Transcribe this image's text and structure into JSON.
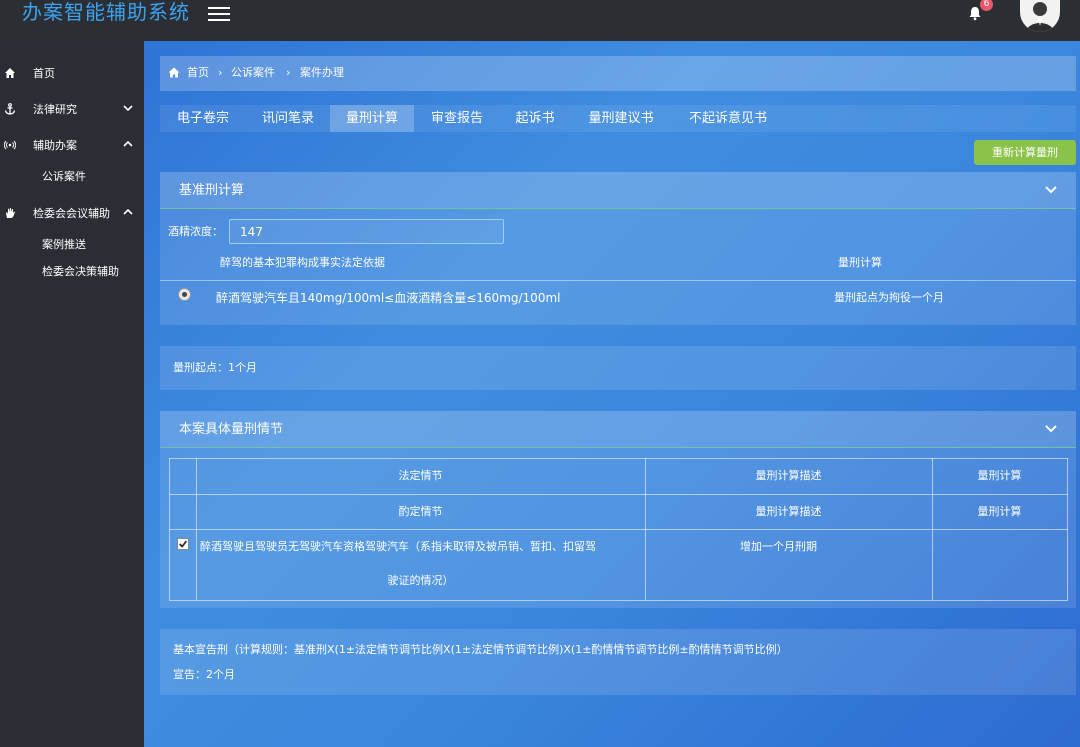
{
  "app": {
    "title": "办案智能辅助系统",
    "notification_count": "6"
  },
  "sidebar": {
    "items": [
      {
        "label": "首页"
      },
      {
        "label": "法律研究"
      },
      {
        "label": "辅助办案"
      },
      {
        "label": "公诉案件"
      },
      {
        "label": "检委会会议辅助"
      },
      {
        "label": "案例推送"
      },
      {
        "label": "检委会决策辅助"
      }
    ]
  },
  "breadcrumb": {
    "home": "首页",
    "level2": "公诉案件",
    "level3": "案件办理"
  },
  "tabs": [
    "电子卷宗",
    "讯问笔录",
    "量刑计算",
    "审查报告",
    "起诉书",
    "量刑建议书",
    "不起诉意见书"
  ],
  "actions": {
    "recalc_label": "重新计算量刑"
  },
  "base_calc": {
    "title": "基准刑计算",
    "alcohol_label": "酒精浓度：",
    "alcohol_value": "147",
    "col_basis": "醉驾的基本犯罪构成事实法定依据",
    "col_calc": "量刑计算",
    "row_basis": "醉酒驾驶汽车且140mg/100ml≤血液酒精含量≤160mg/100ml",
    "row_calc": "量刑起点为拘役一个月"
  },
  "start_point": {
    "text": "量刑起点：1个月"
  },
  "circumstances": {
    "title": "本案具体量刑情节",
    "statutory_header": "法定情节",
    "desc_header": "量刑计算描述",
    "calc_header": "量刑计算",
    "discretionary_header": "酌定情节",
    "desc_header2": "量刑计算描述",
    "calc_header2": "量刑计算",
    "row_text_line1": "醉酒驾驶且驾驶员无驾驶汽车资格驾驶汽车（系指未取得及被吊销、暂扣、扣留驾",
    "row_text_line2": "驶证的情况）",
    "row_desc": "增加一个月刑期",
    "row_calc": ""
  },
  "sentence": {
    "rule": "基本宣告刑（计算规则：基准刑X(1±法定情节调节比例X(1±法定情节调节比例)X(1±酌情情节调节比例±酌情情节调节比例）",
    "result": "宣告：2个月"
  }
}
